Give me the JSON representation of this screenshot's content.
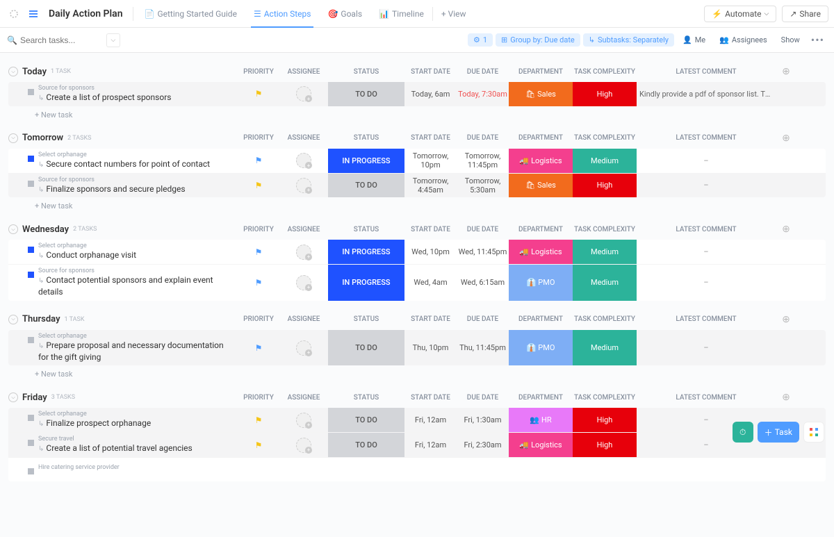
{
  "header": {
    "title": "Daily Action Plan",
    "tabs": [
      {
        "label": "Getting Started Guide",
        "active": false
      },
      {
        "label": "Action Steps",
        "active": true
      },
      {
        "label": "Goals",
        "active": false
      },
      {
        "label": "Timeline",
        "active": false
      }
    ],
    "add_view": "+ View",
    "automate": "Automate",
    "share": "Share"
  },
  "filterbar": {
    "search_placeholder": "Search tasks...",
    "filter_count": "1",
    "group_by": "Group by: Due date",
    "subtasks": "Subtasks: Separately",
    "me": "Me",
    "assignees": "Assignees",
    "show": "Show"
  },
  "columns": {
    "priority": "PRIORITY",
    "assignee": "ASSIGNEE",
    "status": "STATUS",
    "start_date": "START DATE",
    "due_date": "DUE DATE",
    "department": "DEPARTMENT",
    "task_complexity": "TASK COMPLEXITY",
    "latest_comment": "LATEST COMMENT"
  },
  "statuses": {
    "todo": "TO DO",
    "in_progress": "IN PROGRESS"
  },
  "complexity": {
    "high": "High",
    "medium": "Medium"
  },
  "departments": {
    "sales": "Sales",
    "logistics": "Logistics",
    "pmo": "PMO",
    "hr": "HR"
  },
  "new_task": "+ New task",
  "groups": [
    {
      "name": "Today",
      "count": "1 TASK",
      "tasks": [
        {
          "parent": "Source for sponsors",
          "title": "Create a list of prospect sponsors",
          "flag": "yellow",
          "status": "todo",
          "start": "Today, 6am",
          "due": "Today, 7:30am",
          "due_today": true,
          "dept": "sales",
          "dept_emoji": "🛍",
          "complexity": "high",
          "comment": "Kindly provide a pdf of sponsor list. Thank you! 🙏 🙏",
          "sq": "gray"
        }
      ]
    },
    {
      "name": "Tomorrow",
      "count": "2 TASKS",
      "tasks": [
        {
          "parent": "Select orphanage",
          "title": "Secure contact numbers for point of contact",
          "flag": "blue",
          "status": "in_progress",
          "start": "Tomorrow, 10pm",
          "due": "Tomorrow, 11:45pm",
          "dept": "logistics",
          "dept_emoji": "🚚",
          "complexity": "medium",
          "comment": "–",
          "sq": "blue"
        },
        {
          "parent": "Source for sponsors",
          "title": "Finalize sponsors and secure pledges",
          "flag": "yellow",
          "status": "todo",
          "start": "Tomorrow, 4:45am",
          "due": "Tomorrow, 5:30am",
          "dept": "sales",
          "dept_emoji": "🛍",
          "complexity": "high",
          "comment": "–",
          "sq": "gray"
        }
      ]
    },
    {
      "name": "Wednesday",
      "count": "2 TASKS",
      "tasks": [
        {
          "parent": "Select orphanage",
          "title": "Conduct orphanage visit",
          "flag": "blue",
          "status": "in_progress",
          "start": "Wed, 10pm",
          "due": "Wed, 11:45pm",
          "dept": "logistics",
          "dept_emoji": "🚚",
          "complexity": "medium",
          "comment": "–",
          "sq": "blue"
        },
        {
          "parent": "Source for sponsors",
          "title": "Contact potential sponsors and explain event details",
          "flag": "blue",
          "status": "in_progress",
          "start": "Wed, 4am",
          "due": "Wed, 6:15am",
          "dept": "pmo",
          "dept_emoji": "👔",
          "complexity": "medium",
          "comment": "–",
          "sq": "blue"
        }
      ]
    },
    {
      "name": "Thursday",
      "count": "1 TASK",
      "tasks": [
        {
          "parent": "Select orphanage",
          "title": "Prepare proposal and necessary documentation for the gift giving",
          "flag": "blue",
          "status": "todo",
          "start": "Thu, 10pm",
          "due": "Thu, 11:45pm",
          "dept": "pmo",
          "dept_emoji": "👔",
          "complexity": "medium",
          "comment": "–",
          "sq": "gray"
        }
      ]
    },
    {
      "name": "Friday",
      "count": "3 TASKS",
      "tasks": [
        {
          "parent": "Select orphanage",
          "title": "Finalize prospect orphanage",
          "flag": "yellow",
          "status": "todo",
          "start": "Fri, 12am",
          "due": "Fri, 1:30am",
          "dept": "hr",
          "dept_emoji": "👥",
          "complexity": "high",
          "comment": "–",
          "sq": "gray"
        },
        {
          "parent": "Secure travel",
          "title": "Create a list of potential travel agencies",
          "flag": "yellow",
          "status": "todo",
          "start": "Fri, 12am",
          "due": "Fri, 2:30am",
          "dept": "logistics",
          "dept_emoji": "🚚",
          "complexity": "high",
          "comment": "–",
          "sq": "gray"
        },
        {
          "parent": "Hire catering service provider",
          "title": "",
          "flag": "",
          "status": "",
          "start": "",
          "due": "",
          "dept": "",
          "complexity": "",
          "comment": "",
          "sq": "gray",
          "partial": true
        }
      ]
    }
  ],
  "fab": {
    "task": "Task"
  }
}
